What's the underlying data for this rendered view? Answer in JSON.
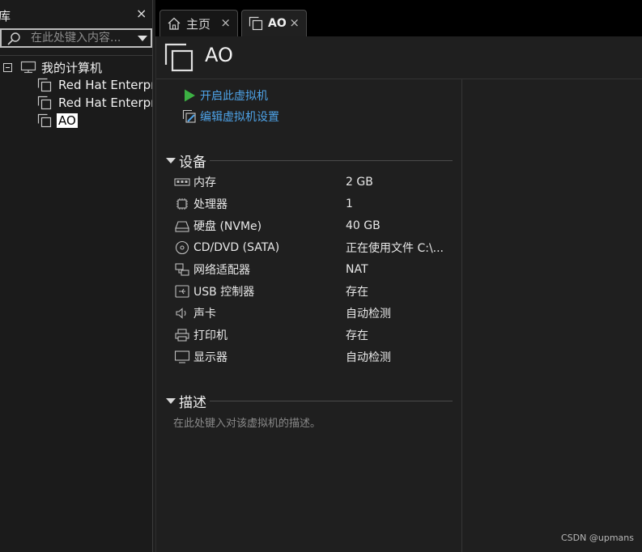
{
  "library": {
    "title": "库",
    "close_glyph": "×",
    "search_placeholder": "在此处键入内容...",
    "tree": {
      "root_label": "我的计算机",
      "vms": [
        {
          "label": "Red Hat Enterprise Linux"
        },
        {
          "label": "Red Hat Enterprise Linux"
        },
        {
          "label": "AO",
          "selected": true
        }
      ]
    }
  },
  "tabs": [
    {
      "label": "主页",
      "icon": "home-icon",
      "close_glyph": "×"
    },
    {
      "label": "AO",
      "icon": "vm-icon",
      "close_glyph": "×",
      "active": true
    }
  ],
  "vm": {
    "name": "AO",
    "actions": {
      "start": "开启此虚拟机",
      "edit": "编辑虚拟机设置"
    },
    "devices_heading": "设备",
    "devices": [
      {
        "name": "内存",
        "value": "2 GB",
        "icon": "memory-icon"
      },
      {
        "name": "处理器",
        "value": "1",
        "icon": "cpu-icon"
      },
      {
        "name": "硬盘 (NVMe)",
        "value": "40 GB",
        "icon": "hard-disk-icon"
      },
      {
        "name": "CD/DVD (SATA)",
        "value": "正在使用文件 C:\\...",
        "icon": "cd-dvd-icon"
      },
      {
        "name": "网络适配器",
        "value": "NAT",
        "icon": "network-adapter-icon"
      },
      {
        "name": "USB 控制器",
        "value": "存在",
        "icon": "usb-icon"
      },
      {
        "name": "声卡",
        "value": "自动检测",
        "icon": "sound-card-icon"
      },
      {
        "name": "打印机",
        "value": "存在",
        "icon": "printer-icon"
      },
      {
        "name": "显示器",
        "value": "自动检测",
        "icon": "display-icon"
      }
    ],
    "description_heading": "描述",
    "description_placeholder": "在此处键入对该虚拟机的描述。"
  },
  "watermark": "CSDN @upmans",
  "colors": {
    "accent_link": "#4ea3e8",
    "play_green": "#3cb043",
    "background": "#1f1f1f",
    "tabbar": "#000000"
  }
}
